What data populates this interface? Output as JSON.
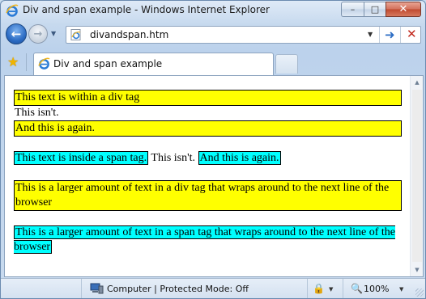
{
  "window": {
    "title": "Div and span example - Windows Internet Explorer"
  },
  "caption_buttons": {
    "minimize": "–",
    "maximize": "□",
    "close": "✕"
  },
  "nav": {
    "back_glyph": "←",
    "forward_glyph": "→",
    "history_drop": "▼",
    "address": "divandspan.htm",
    "address_drop": "▼",
    "go_glyph": "➜",
    "stop_glyph": "✕"
  },
  "tabs": {
    "favorites_glyph": "★",
    "active_label": "Div and span example"
  },
  "page": {
    "div1": "This text is within a div tag",
    "div2": "This isn't.",
    "div3": "And this is again.",
    "span1": "This text is inside a span tag.",
    "span_gap": " This isn't. ",
    "span2": "And this is again.",
    "long_div": "This is a larger amount of text in a div tag that wraps around to the next line of the browser",
    "long_span": "This is a larger amount of text in a span tag that wraps around to the next line of the browser"
  },
  "scrollbar": {
    "up": "▲",
    "down": "▼"
  },
  "status": {
    "zone": "Computer | Protected Mode: Off",
    "lock_glyph": "🔒",
    "drop": "▼",
    "zoom_glyph": "🔍",
    "zoom": "100%"
  },
  "colors": {
    "div_highlight": "#ffff00",
    "span_highlight": "#00ffff"
  }
}
